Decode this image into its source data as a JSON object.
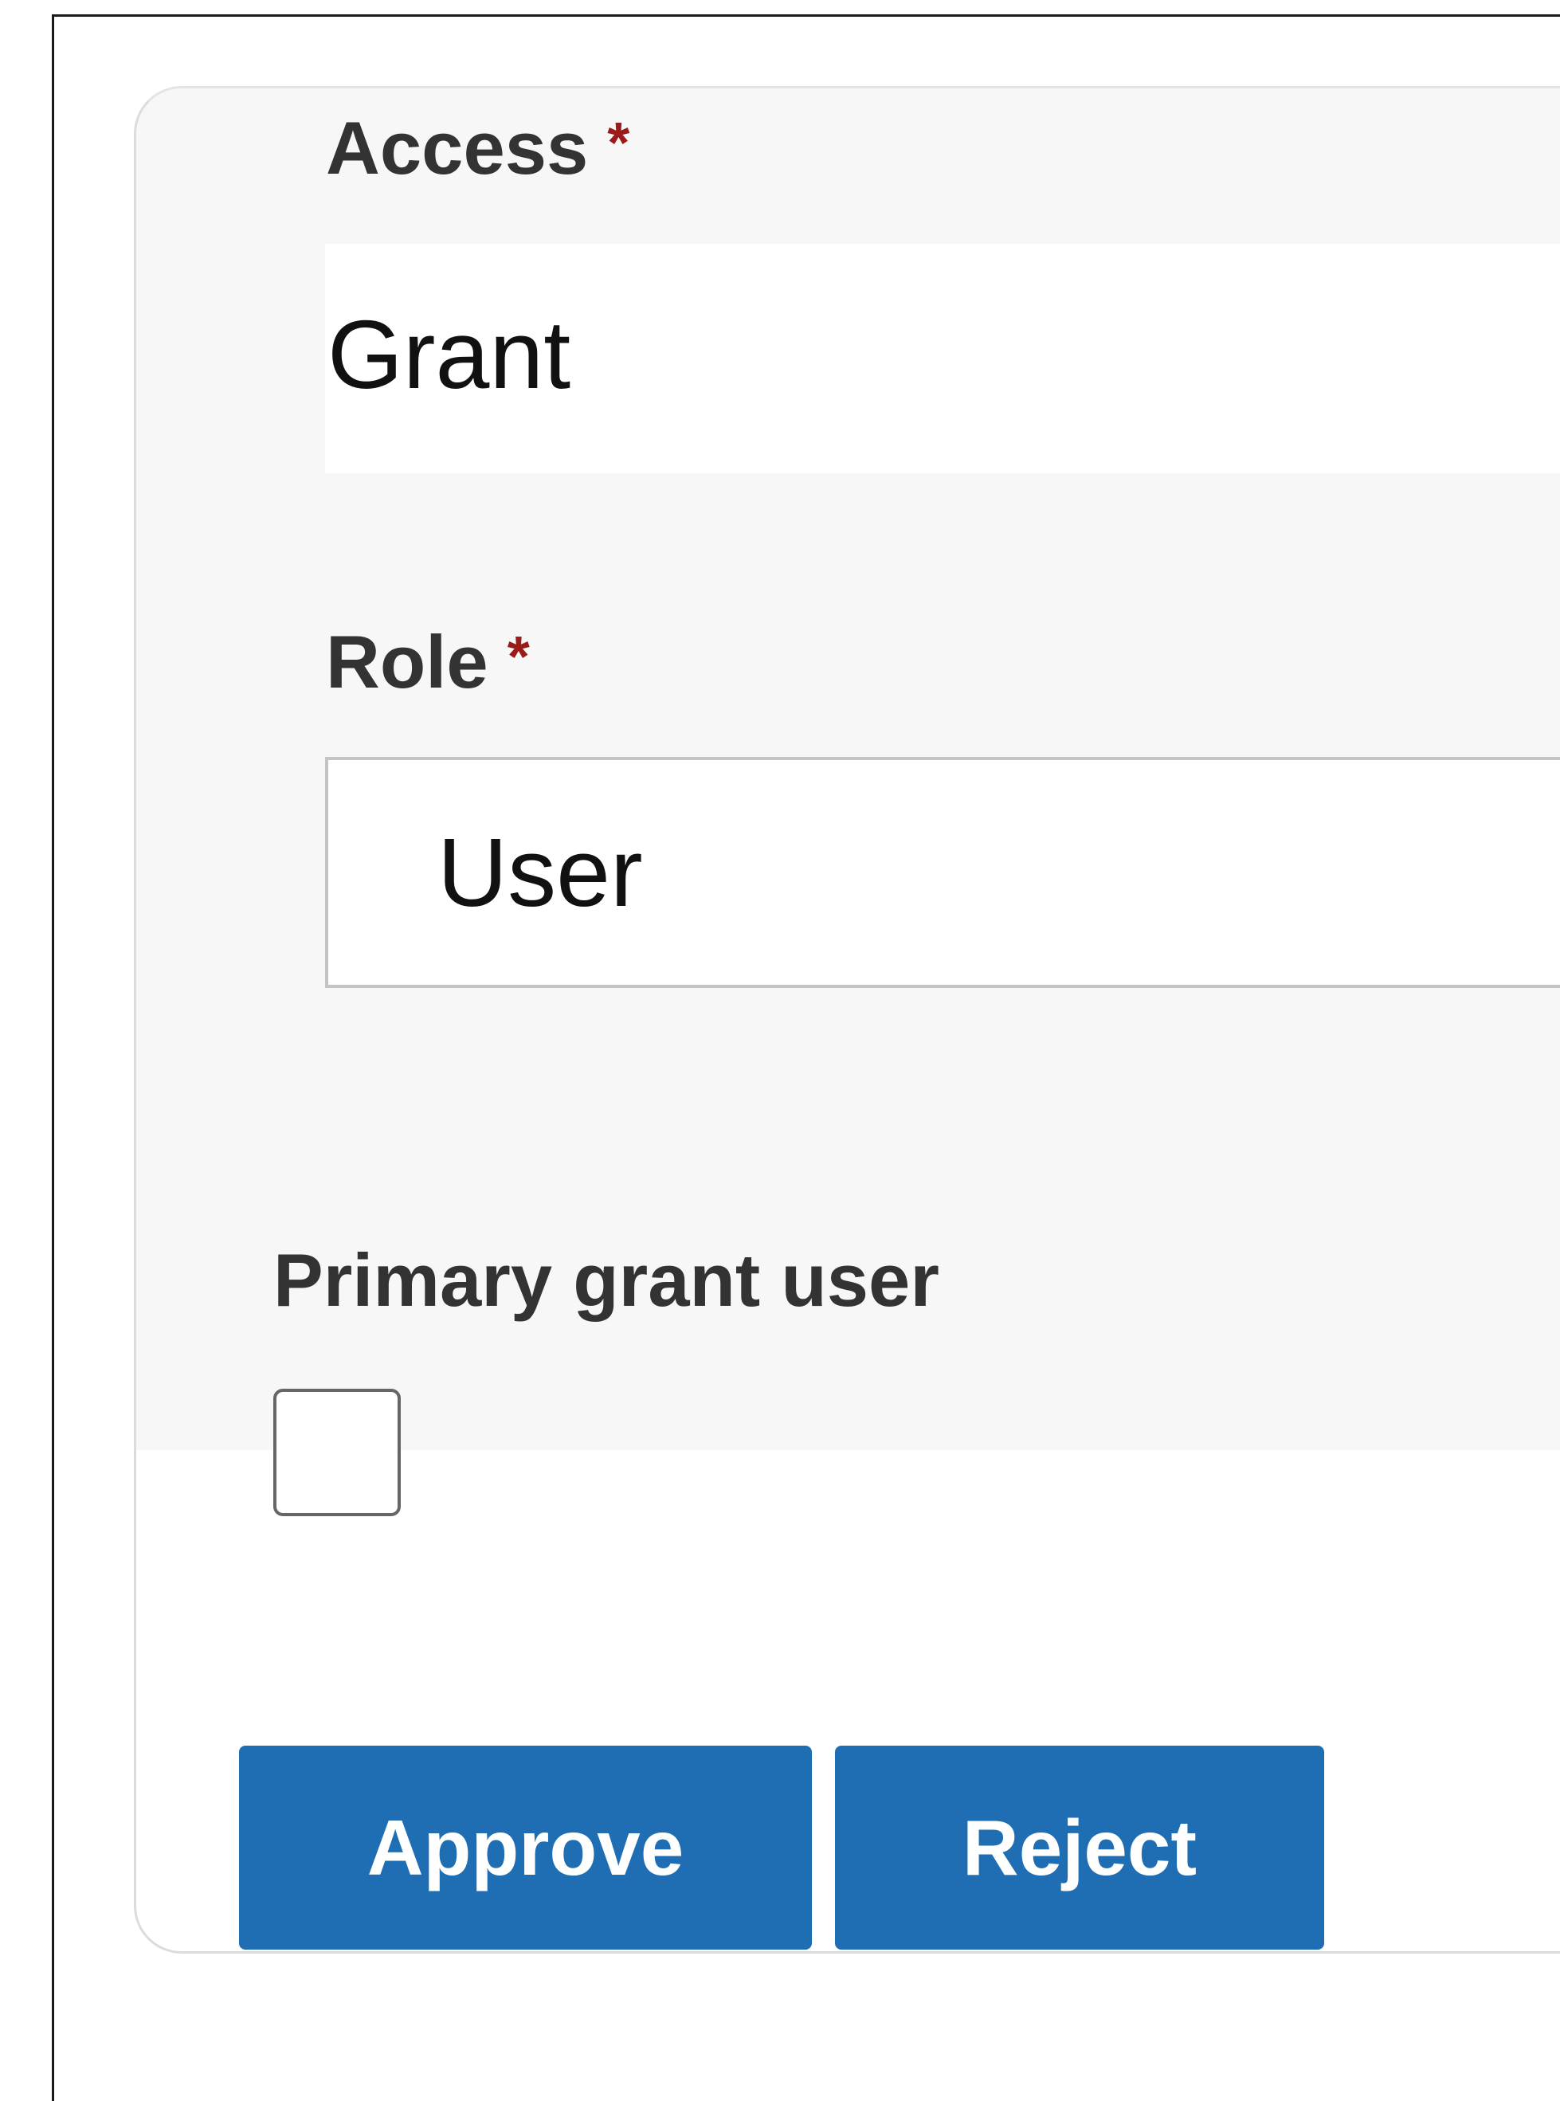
{
  "form": {
    "access": {
      "label": "Access",
      "required_marker": "*",
      "value": "Grant"
    },
    "role": {
      "label": "Role",
      "required_marker": "*",
      "selected": "User"
    },
    "primary_grant_user": {
      "label": "Primary grant user",
      "checked": false
    }
  },
  "actions": {
    "approve_label": "Approve",
    "reject_label": "Reject"
  },
  "colors": {
    "button_bg": "#1f6db3",
    "required_star": "#9b1a1a",
    "panel_bg": "#f7f7f7"
  }
}
